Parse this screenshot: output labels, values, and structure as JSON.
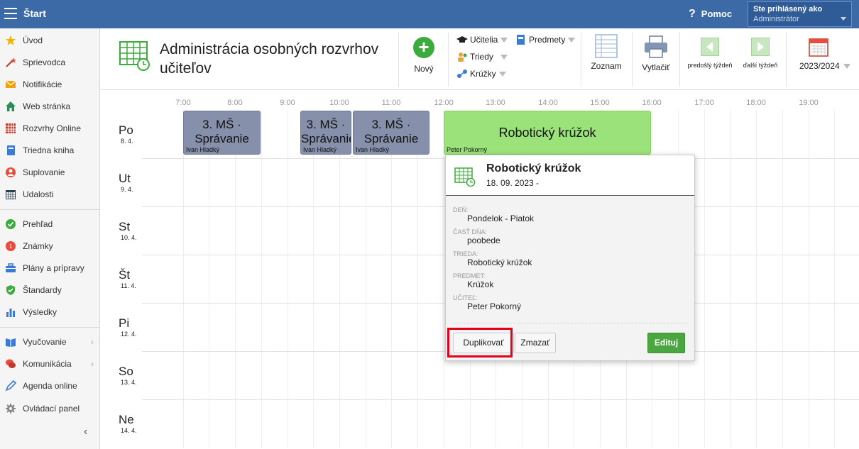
{
  "topbar": {
    "title": "Štart",
    "help_label": "Pomoc",
    "help_symbol": "?",
    "user_line1": "Ste prihlásený ako",
    "user_line2": "Administrátor"
  },
  "sidebar": {
    "items": [
      {
        "label": "Úvod",
        "icon": "star-icon"
      },
      {
        "label": "Sprievodca",
        "icon": "wand-icon"
      },
      {
        "label": "Notifikácie",
        "icon": "envelope-icon"
      },
      {
        "label": "Web stránka",
        "icon": "home-icon"
      },
      {
        "label": "Rozvrhy Online",
        "icon": "timetable-icon"
      },
      {
        "label": "Triedna kniha",
        "icon": "book-icon"
      },
      {
        "label": "Suplovanie",
        "icon": "person-icon"
      },
      {
        "label": "Udalosti",
        "icon": "calendar-icon"
      },
      {
        "label": "Prehľad",
        "icon": "check-circle-icon"
      },
      {
        "label": "Známky",
        "icon": "grades-icon"
      },
      {
        "label": "Plány a prípravy",
        "icon": "briefcase-icon"
      },
      {
        "label": "Štandardy",
        "icon": "shield-check-icon"
      },
      {
        "label": "Výsledky",
        "icon": "bar-chart-icon"
      },
      {
        "label": "Vyučovanie",
        "icon": "open-book-icon"
      },
      {
        "label": "Komunikácia",
        "icon": "chat-icon"
      },
      {
        "label": "Agenda online",
        "icon": "pen-icon"
      },
      {
        "label": "Ovládací panel",
        "icon": "gear-icon"
      }
    ],
    "collapse_symbol": "‹",
    "submenu_symbol": "›"
  },
  "header": {
    "title": "Administrácia osobných rozvrhov učiteľov",
    "new_label": "Nový",
    "new_symbol": "+",
    "filters": {
      "teachers": "Učitelia",
      "subjects": "Predmety",
      "classes": "Triedy",
      "clubs": "Krúžky"
    },
    "list_label": "Zoznam",
    "print_label": "Vytlačiť",
    "prev_week": "predošlý týždeň",
    "next_week": "ďalší týždeň",
    "year": "2023/2024"
  },
  "schedule": {
    "hours": [
      "7:00",
      "8:00",
      "9:00",
      "10:00",
      "11:00",
      "12:00",
      "13:00",
      "14:00",
      "15:00",
      "16:00",
      "17:00",
      "18:00",
      "19:00"
    ],
    "days": [
      {
        "name": "Po",
        "date": "8. 4."
      },
      {
        "name": "Ut",
        "date": "9. 4."
      },
      {
        "name": "St",
        "date": "10. 4."
      },
      {
        "name": "Št",
        "date": "11. 4."
      },
      {
        "name": "Pi",
        "date": "12. 4."
      },
      {
        "name": "So",
        "date": "13. 4."
      },
      {
        "name": "Ne",
        "date": "14. 4."
      }
    ],
    "events": [
      {
        "title": "3. MŠ · Správanie",
        "teacher": "Ivan Hladký"
      },
      {
        "title": "3. MŠ · Správanie",
        "teacher": "Ivan Hladký"
      },
      {
        "title": "3. MŠ · Správanie",
        "teacher": "Ivan Hladký"
      },
      {
        "title": "Robotický krúžok",
        "teacher": "Peter Pokorný"
      }
    ]
  },
  "popup": {
    "title": "Robotický krúžok",
    "date": "18. 09. 2023 -",
    "fields": [
      {
        "label": "DEŇ:",
        "value": "Pondelok - Piatok"
      },
      {
        "label": "ČASŤ DŇA:",
        "value": "poobede"
      },
      {
        "label": "TRIEDA:",
        "value": "Robotický krúžok"
      },
      {
        "label": "PREDMET:",
        "value": "Krúžok"
      },
      {
        "label": "UČITEĽ:",
        "value": "Peter Pokorný"
      }
    ],
    "duplicate_label": "Duplikovať",
    "delete_label": "Zmazať",
    "edit_label": "Edituj"
  },
  "colors": {
    "topbar": "#3b6aa6",
    "event_gray": "#8690aa",
    "event_green": "#9ce27a",
    "edit_button": "#4aa63e",
    "highlight": "#e3001b"
  }
}
